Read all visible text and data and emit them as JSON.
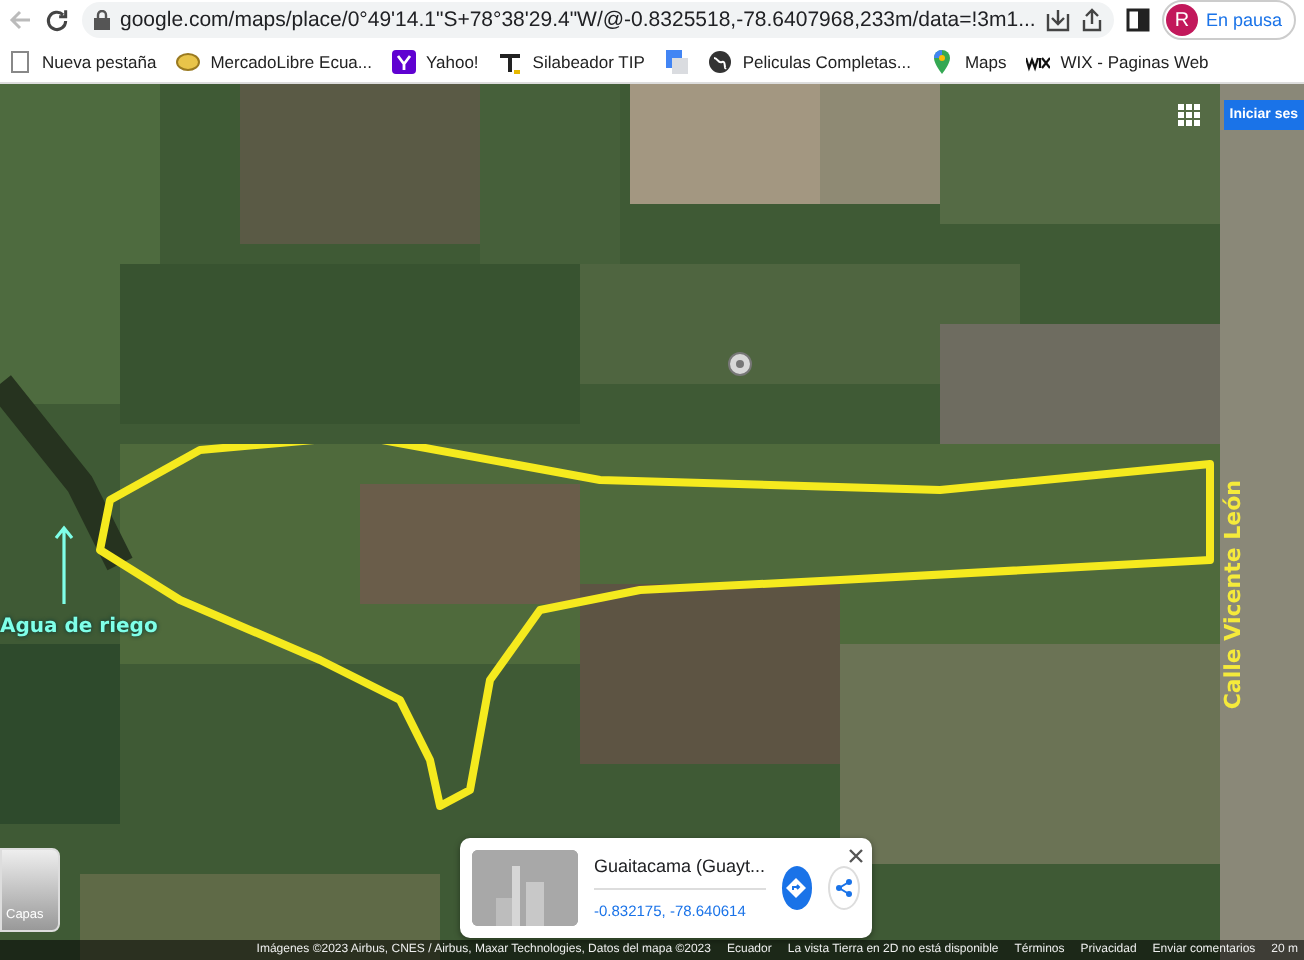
{
  "browser": {
    "url": "google.com/maps/place/0°49'14.1\"S+78°38'29.4\"W/@-0.8325518,-78.6407968,233m/data=!3m1...",
    "back_disabled": true,
    "profile_initial": "R",
    "profile_status": "En pausa"
  },
  "bookmarks": [
    {
      "kind": "page",
      "label": "Nueva pestaña"
    },
    {
      "kind": "coin",
      "label": "MercadoLibre Ecua..."
    },
    {
      "kind": "yahoo",
      "label": "Yahoo!"
    },
    {
      "kind": "tip",
      "label": "Silabeador TIP"
    },
    {
      "kind": "translate"
    },
    {
      "kind": "globe",
      "label": "Peliculas Completas..."
    },
    {
      "kind": "pin",
      "label": "Maps"
    },
    {
      "kind": "wix",
      "label": "WIX - Paginas Web"
    }
  ],
  "map": {
    "signin_button": "Iniciar ses",
    "annotation": "Agua de riego",
    "street_label": "Calle Vicente León",
    "layers_button": "Capas",
    "place_card": {
      "title": "Guaitacama (Guayt...",
      "coords": "-0.832175, -78.640614"
    },
    "footer": [
      "Imágenes ©2023 Airbus, CNES / Airbus, Maxar Technologies, Datos del mapa ©2023",
      "Ecuador",
      "La vista Tierra en 2D no está disponible",
      "Términos",
      "Privacidad",
      "Enviar comentarios",
      "20 m"
    ]
  }
}
